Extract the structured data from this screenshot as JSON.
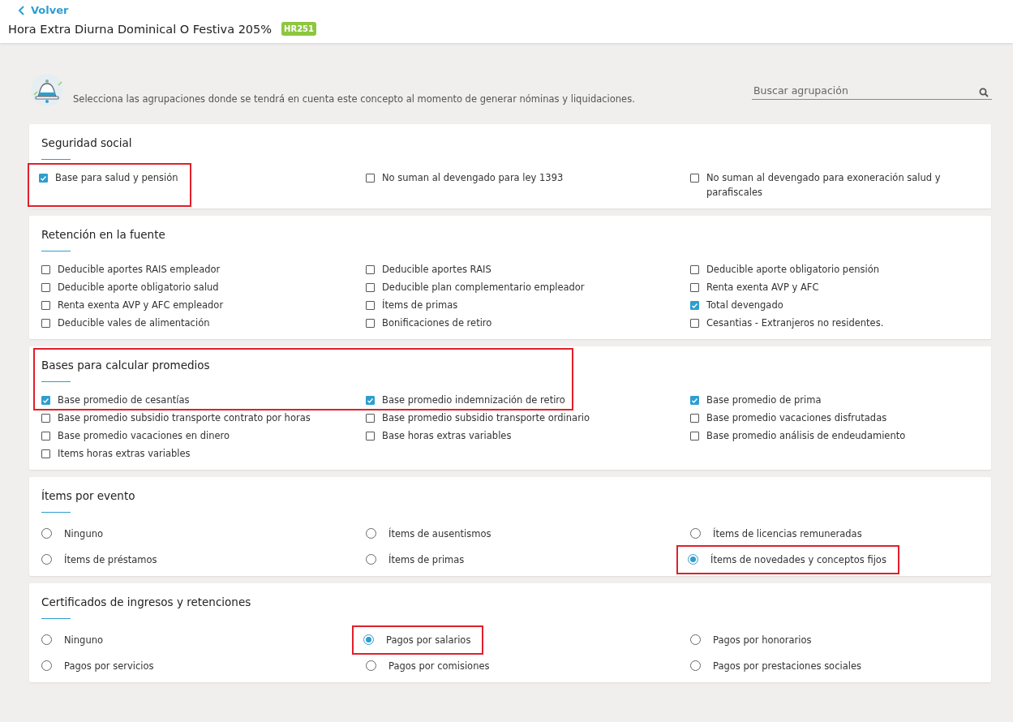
{
  "header": {
    "back_link": "Volver",
    "title": "Hora Extra Diurna Dominical O Festiva 205%",
    "code_badge": "HR251"
  },
  "intro": {
    "text": "Selecciona las agrupaciones donde se tendrá en cuenta este concepto al momento de generar nóminas y liquidaciones.",
    "search": {
      "placeholder": "Buscar agrupación"
    }
  },
  "sections": [
    {
      "title": "Seguridad social",
      "kind": "checkbox",
      "title_highlighted": false,
      "items": [
        {
          "label": "Base para salud y pensión",
          "checked": true,
          "highlighted": true
        },
        {
          "label": "No suman al devengado para ley 1393",
          "checked": false,
          "highlighted": false
        },
        {
          "label": "No suman al devengado para exoneración salud y parafiscales",
          "checked": false,
          "highlighted": false
        }
      ]
    },
    {
      "title": "Retención en la fuente",
      "kind": "checkbox",
      "title_highlighted": false,
      "items": [
        {
          "label": "Deducible aportes RAIS empleador",
          "checked": false,
          "highlighted": false
        },
        {
          "label": "Deducible aportes RAIS",
          "checked": false,
          "highlighted": false
        },
        {
          "label": "Deducible aporte obligatorio pensión",
          "checked": false,
          "highlighted": false
        },
        {
          "label": "Deducible aporte obligatorio salud",
          "checked": false,
          "highlighted": false
        },
        {
          "label": "Deducible plan complementario empleador",
          "checked": false,
          "highlighted": false
        },
        {
          "label": "Renta exenta AVP y AFC",
          "checked": false,
          "highlighted": false
        },
        {
          "label": "Renta exenta AVP y AFC empleador",
          "checked": false,
          "highlighted": false
        },
        {
          "label": "Ítems de primas",
          "checked": false,
          "highlighted": false
        },
        {
          "label": "Total devengado",
          "checked": true,
          "highlighted": false
        },
        {
          "label": "Deducible vales de alimentación",
          "checked": false,
          "highlighted": false
        },
        {
          "label": "Bonificaciones de retiro",
          "checked": false,
          "highlighted": false
        },
        {
          "label": "Cesantias - Extranjeros no residentes.",
          "checked": false,
          "highlighted": false
        }
      ]
    },
    {
      "title": "Bases para calcular promedios",
      "kind": "checkbox",
      "title_highlighted": true,
      "items": [
        {
          "label": "Base promedio de cesantías",
          "checked": true,
          "highlighted": false
        },
        {
          "label": "Base promedio indemnización de retiro",
          "checked": true,
          "highlighted": false
        },
        {
          "label": "Base promedio de prima",
          "checked": true,
          "highlighted": false
        },
        {
          "label": "Base promedio subsidio transporte contrato por horas",
          "checked": false,
          "highlighted": false
        },
        {
          "label": "Base promedio subsidio transporte ordinario",
          "checked": false,
          "highlighted": false
        },
        {
          "label": "Base promedio vacaciones disfrutadas",
          "checked": false,
          "highlighted": false
        },
        {
          "label": "Base promedio vacaciones en dinero",
          "checked": false,
          "highlighted": false
        },
        {
          "label": "Base horas extras variables",
          "checked": false,
          "highlighted": false
        },
        {
          "label": "Base promedio análisis de endeudamiento",
          "checked": false,
          "highlighted": false
        },
        {
          "label": "Items horas extras variables",
          "checked": false,
          "highlighted": false
        }
      ]
    },
    {
      "title": "Ítems por evento",
      "kind": "radio",
      "title_highlighted": false,
      "items": [
        {
          "label": "Ninguno",
          "selected": false,
          "highlighted": false
        },
        {
          "label": "Ítems de ausentismos",
          "selected": false,
          "highlighted": false
        },
        {
          "label": "Ítems de licencias remuneradas",
          "selected": false,
          "highlighted": false
        },
        {
          "label": "Ítems de préstamos",
          "selected": false,
          "highlighted": false
        },
        {
          "label": "Ítems de primas",
          "selected": false,
          "highlighted": false
        },
        {
          "label": "Ítems de novedades y conceptos fijos",
          "selected": true,
          "highlighted": true
        }
      ]
    },
    {
      "title": "Certificados de ingresos y retenciones",
      "kind": "radio",
      "title_highlighted": false,
      "items": [
        {
          "label": "Ninguno",
          "selected": false,
          "highlighted": false
        },
        {
          "label": "Pagos por salarios",
          "selected": true,
          "highlighted": true
        },
        {
          "label": "Pagos por honorarios",
          "selected": false,
          "highlighted": false
        },
        {
          "label": "Pagos por servicios",
          "selected": false,
          "highlighted": false
        },
        {
          "label": "Pagos por comisiones",
          "selected": false,
          "highlighted": false
        },
        {
          "label": "Pagos por prestaciones sociales",
          "selected": false,
          "highlighted": false
        }
      ]
    }
  ]
}
